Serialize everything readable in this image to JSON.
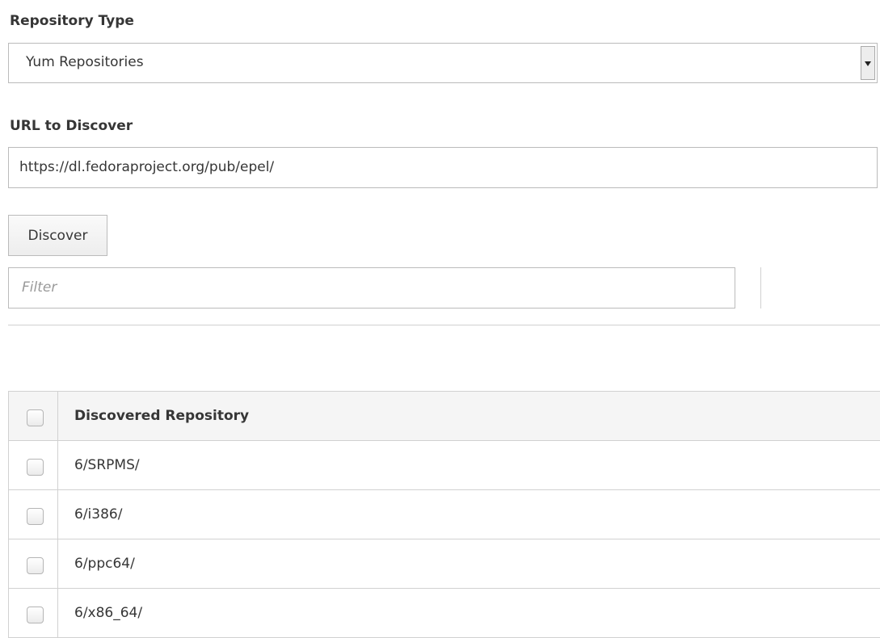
{
  "repository_type": {
    "label": "Repository Type",
    "selected": "Yum Repositories"
  },
  "url_discover": {
    "label": "URL to Discover",
    "value": "https://dl.fedoraproject.org/pub/epel/"
  },
  "discover_button": {
    "label": "Discover"
  },
  "filter": {
    "placeholder": "Filter"
  },
  "table": {
    "header": "Discovered Repository",
    "rows": [
      {
        "name": "6/SRPMS/"
      },
      {
        "name": "6/i386/"
      },
      {
        "name": "6/ppc64/"
      },
      {
        "name": "6/x86_64/"
      }
    ]
  }
}
